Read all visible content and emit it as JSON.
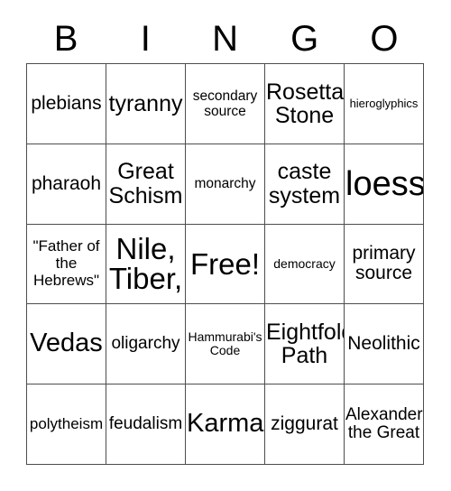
{
  "card": {
    "header_letters": [
      "B",
      "I",
      "N",
      "G",
      "O"
    ],
    "rows": [
      [
        {
          "text": "plebians",
          "size": "fs-21"
        },
        {
          "text": "tyranny",
          "size": "fs-25"
        },
        {
          "text": "secondary source",
          "size": "fs-15"
        },
        {
          "text": "Rosetta Stone",
          "size": "fs-25"
        },
        {
          "text": "hieroglyphics",
          "size": "fs-13"
        }
      ],
      [
        {
          "text": "pharaoh",
          "size": "fs-21"
        },
        {
          "text": "Great Schism",
          "size": "fs-25"
        },
        {
          "text": "monarchy",
          "size": "fs-15"
        },
        {
          "text": "caste system",
          "size": "fs-25"
        },
        {
          "text": "loess",
          "size": "fs-38"
        }
      ],
      [
        {
          "text": "\"Father of the Hebrews\"",
          "size": "fs-17"
        },
        {
          "text": "Nile, Tiber,",
          "size": "fs-33"
        },
        {
          "text": "Free!",
          "size": "fs-33"
        },
        {
          "text": "democracy",
          "size": "fs-14"
        },
        {
          "text": "primary source",
          "size": "fs-21"
        }
      ],
      [
        {
          "text": "Vedas",
          "size": "fs-29"
        },
        {
          "text": "oligarchy",
          "size": "fs-19"
        },
        {
          "text": "Hammurabi's Code",
          "size": "fs-14"
        },
        {
          "text": "Eightfold Path",
          "size": "fs-25"
        },
        {
          "text": "Neolithic",
          "size": "fs-21"
        }
      ],
      [
        {
          "text": "polytheism",
          "size": "fs-17"
        },
        {
          "text": "feudalism",
          "size": "fs-19"
        },
        {
          "text": "Karma",
          "size": "fs-29"
        },
        {
          "text": "ziggurat",
          "size": "fs-21"
        },
        {
          "text": "Alexander the Great",
          "size": "fs-19"
        }
      ]
    ]
  },
  "colors": {
    "background": "#ffffff",
    "text": "#000000",
    "grid_line": "#4d4d4d"
  }
}
